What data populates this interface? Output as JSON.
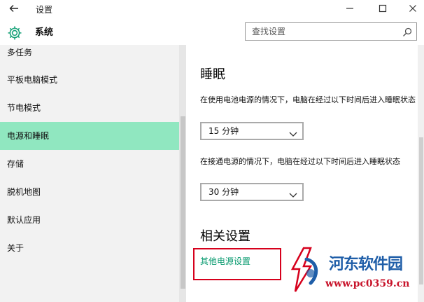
{
  "window": {
    "title": "设置",
    "back_icon": "back-arrow-icon",
    "controls": [
      "minimize-icon",
      "maximize-icon",
      "close-icon"
    ]
  },
  "header": {
    "title": "系统",
    "icon": "gear-icon",
    "search_placeholder": "查找设置",
    "search_icon": "search-icon"
  },
  "sidebar": {
    "items": [
      {
        "label": "多任务"
      },
      {
        "label": "平板电脑模式"
      },
      {
        "label": "节电模式"
      },
      {
        "label": "电源和睡眠",
        "selected": true
      },
      {
        "label": "存储"
      },
      {
        "label": "脱机地图"
      },
      {
        "label": "默认应用"
      },
      {
        "label": "关于"
      }
    ]
  },
  "main": {
    "sleep_title": "睡眠",
    "battery_desc": "在使用电池电源的情况下，电脑在经过以下时间后进入睡眠状态",
    "battery_value": "15 分钟",
    "plugged_desc": "在接通电源的情况下，电脑在经过以下时间后进入睡眠状态",
    "plugged_value": "30 分钟",
    "related_title": "相关设置",
    "other_power_link": "其他电源设置"
  },
  "watermark": {
    "name": "河东软件园",
    "url": "www.pc0359.cn"
  },
  "colors": {
    "selected_item": "#90e7c0",
    "link": "#0a9b70",
    "highlight_box": "#d6001c",
    "watermark_blue": "#1f5ea8",
    "watermark_red": "#c8142b"
  }
}
